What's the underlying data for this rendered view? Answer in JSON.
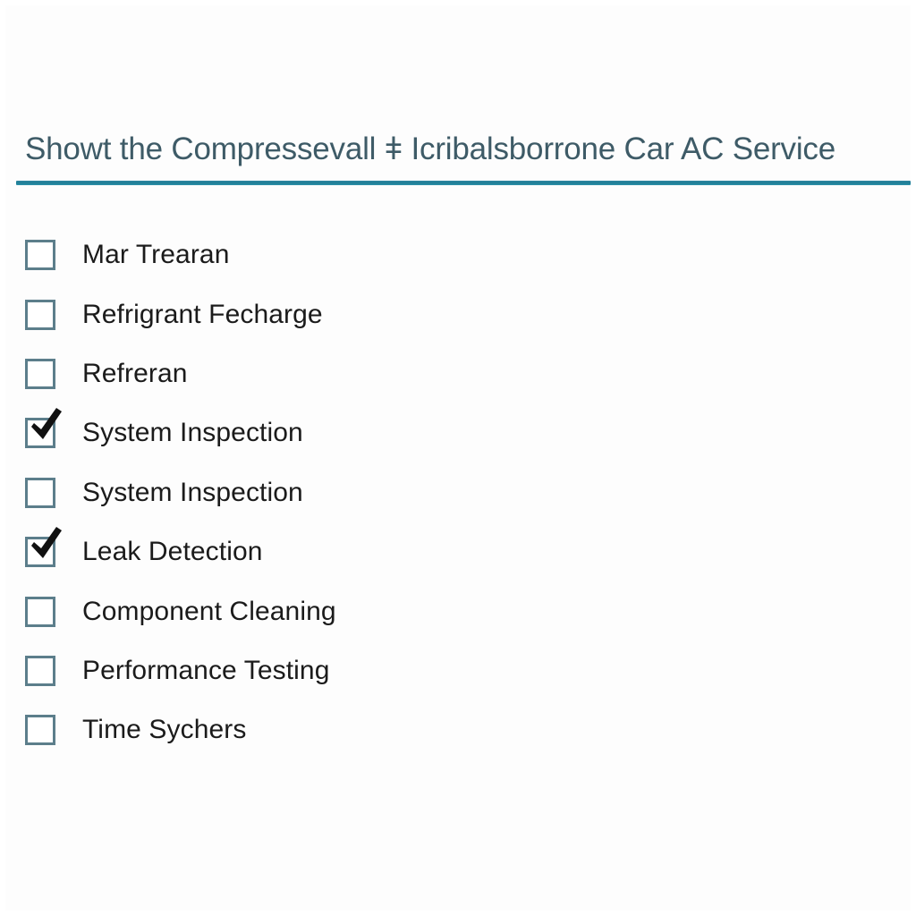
{
  "header": {
    "title": "Showt the Compressevall ǂ Icribalsborrone Car AC Service",
    "rule_color": "#1f7e96",
    "title_color": "#3e5b67"
  },
  "checklist": {
    "checkbox_border_color": "#5c7e8b",
    "check_mark_color": "#111111",
    "label_color": "#1b1b1b",
    "items": [
      {
        "label": "Mar Trearan",
        "checked": false,
        "state": "unchecked"
      },
      {
        "label": "Refrigrant Fecharge",
        "checked": false,
        "state": "unchecked"
      },
      {
        "label": "Refreran",
        "checked": false,
        "state": "unchecked"
      },
      {
        "label": "System Inspection",
        "checked": true,
        "state": "checked"
      },
      {
        "label": "System Inspection",
        "checked": false,
        "state": "unchecked"
      },
      {
        "label": "Leak Detection",
        "checked": true,
        "state": "checked"
      },
      {
        "label": "Component Cleaning",
        "checked": false,
        "state": "unchecked"
      },
      {
        "label": "Performance Testing",
        "checked": false,
        "state": "unchecked"
      },
      {
        "label": "Time Sychers",
        "checked": false,
        "state": "unchecked"
      }
    ]
  }
}
